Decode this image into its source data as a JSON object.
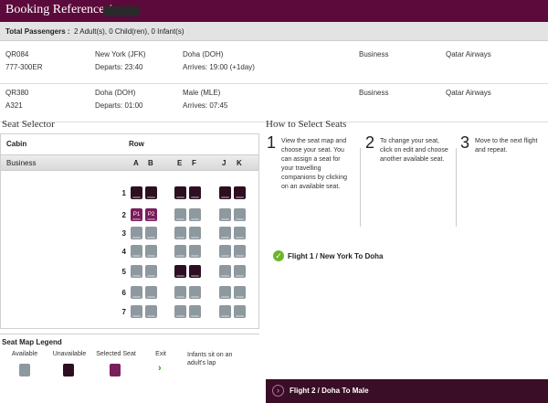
{
  "header": {
    "title": "Booking Reference /"
  },
  "passengers": {
    "label": "Total Passengers :",
    "value": "2 Adult(s), 0 Child(ren), 0 Infant(s)"
  },
  "flights": [
    {
      "number": "QR084",
      "aircraft": "777-300ER",
      "from": "New York (JFK)",
      "departs": "Departs: 23:40",
      "to": "Doha (DOH)",
      "arrives": "Arrives: 19:00 (+1day)",
      "class": "Business",
      "airline": "Qatar Airways"
    },
    {
      "number": "QR380",
      "aircraft": "A321",
      "from": "Doha (DOH)",
      "departs": "Departs: 01:00",
      "to": "Male (MLE)",
      "arrives": "Arrives: 07:45",
      "class": "Business",
      "airline": "Qatar Airways"
    }
  ],
  "seat_selector": {
    "title": "Seat Selector",
    "cabin_header": "Cabin",
    "row_header": "Row",
    "cabin": "Business",
    "columns": [
      "A",
      "B",
      "E",
      "F",
      "J",
      "K"
    ],
    "rows": [
      {
        "num": "1",
        "seats": [
          "unavailable",
          "unavailable",
          "unavailable",
          "unavailable",
          "unavailable",
          "unavailable"
        ]
      },
      {
        "num": "2",
        "seats": [
          "selected",
          "selected",
          "available",
          "available",
          "available",
          "available"
        ],
        "labels": [
          "P1",
          "P2",
          "",
          "",
          "",
          ""
        ]
      },
      {
        "num": "3",
        "seats": [
          "available",
          "available",
          "available",
          "available",
          "available",
          "available"
        ]
      },
      {
        "num": "4",
        "seats": [
          "available",
          "available",
          "available",
          "available",
          "available",
          "available"
        ]
      },
      {
        "num": "5",
        "seats": [
          "available",
          "available",
          "unavailable",
          "unavailable",
          "available",
          "available"
        ]
      },
      {
        "num": "6",
        "seats": [
          "available",
          "available",
          "available",
          "available",
          "available",
          "available"
        ]
      },
      {
        "num": "7",
        "seats": [
          "available",
          "available",
          "available",
          "available",
          "available",
          "available"
        ]
      }
    ]
  },
  "legend": {
    "title": "Seat Map Legend",
    "available": "Available",
    "unavailable": "Unavailable",
    "selected": "Selected Seat",
    "exit": "Exit",
    "infants": "Infants sit on an adult's lap"
  },
  "how_to": {
    "title": "How to Select Seats",
    "steps": [
      {
        "num": "1",
        "text": "View the seat map and choose your seat. You can assign a seat for your travelling companions by clicking on an available seat."
      },
      {
        "num": "2",
        "text": "To change your seat, click on edit and choose another available seat."
      },
      {
        "num": "3",
        "text": "Move to the next flight and repeat."
      }
    ]
  },
  "flight_tabs": {
    "flight1": "Flight 1 / New York To Doha",
    "flight2": "Flight 2 / Doha To Male"
  },
  "colors": {
    "header": "#5c0a3c",
    "available": "#8e989f",
    "unavailable": "#2d0f21",
    "selected": "#7b1c5c",
    "check": "#6fb52c",
    "exit": "#3c9a1e"
  }
}
